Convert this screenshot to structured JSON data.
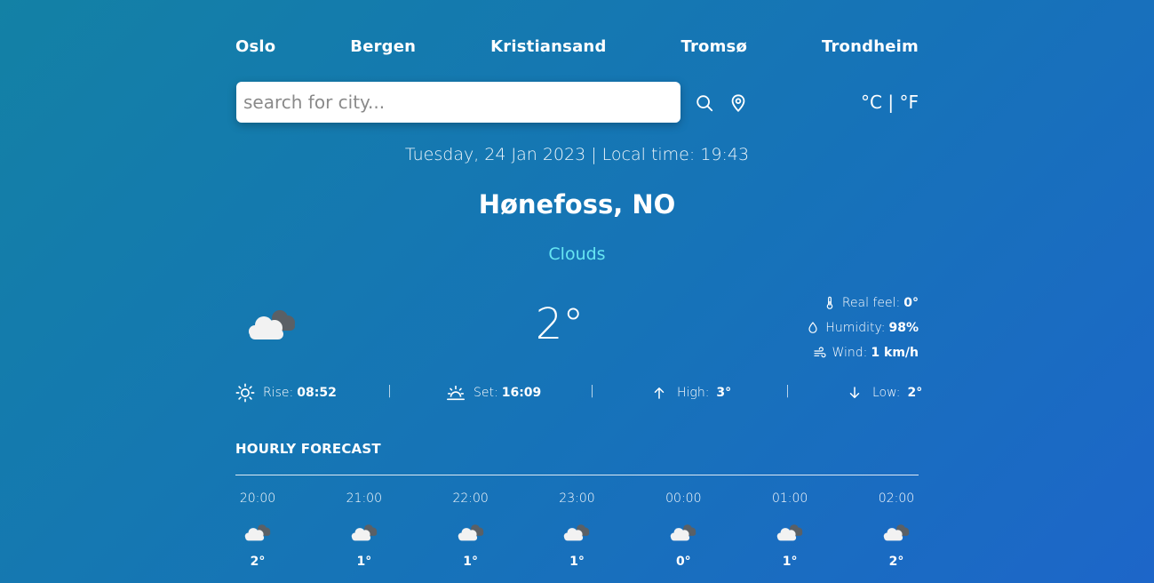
{
  "cities": [
    "Oslo",
    "Bergen",
    "Kristiansand",
    "Tromsø",
    "Trondheim"
  ],
  "search": {
    "placeholder": "search for city..."
  },
  "units": {
    "celsius": "°C",
    "separator": "|",
    "fahrenheit": "°F"
  },
  "datetime": "Tuesday, 24 Jan 2023 | Local time: 19:43",
  "location": "Hønefoss, NO",
  "condition": "Clouds",
  "current": {
    "icon": "broken-clouds-icon",
    "temp": "2°",
    "real_feel_label": "Real feel:",
    "real_feel": "0°",
    "humidity_label": "Humidity:",
    "humidity": "98%",
    "wind_label": "Wind:",
    "wind": "1 km/h"
  },
  "sun": {
    "rise_label": "Rise:",
    "rise": "08:52",
    "set_label": "Set:",
    "set": "16:09",
    "high_label": "High:",
    "high": "3°",
    "low_label": "Low:",
    "low": "2°",
    "separator": "|"
  },
  "forecast": {
    "title": "HOURLY FORECAST",
    "hours": [
      {
        "time": "20:00",
        "temp": "2°",
        "icon": "broken-clouds-icon"
      },
      {
        "time": "21:00",
        "temp": "1°",
        "icon": "broken-clouds-icon"
      },
      {
        "time": "22:00",
        "temp": "1°",
        "icon": "broken-clouds-icon"
      },
      {
        "time": "23:00",
        "temp": "1°",
        "icon": "broken-clouds-icon"
      },
      {
        "time": "00:00",
        "temp": "0°",
        "icon": "broken-clouds-icon"
      },
      {
        "time": "01:00",
        "temp": "1°",
        "icon": "broken-clouds-icon"
      },
      {
        "time": "02:00",
        "temp": "2°",
        "icon": "broken-clouds-icon"
      }
    ]
  },
  "colors": {
    "accent": "#67e6f2",
    "background_start": "#1381a5",
    "background_end": "#1d66c9"
  }
}
